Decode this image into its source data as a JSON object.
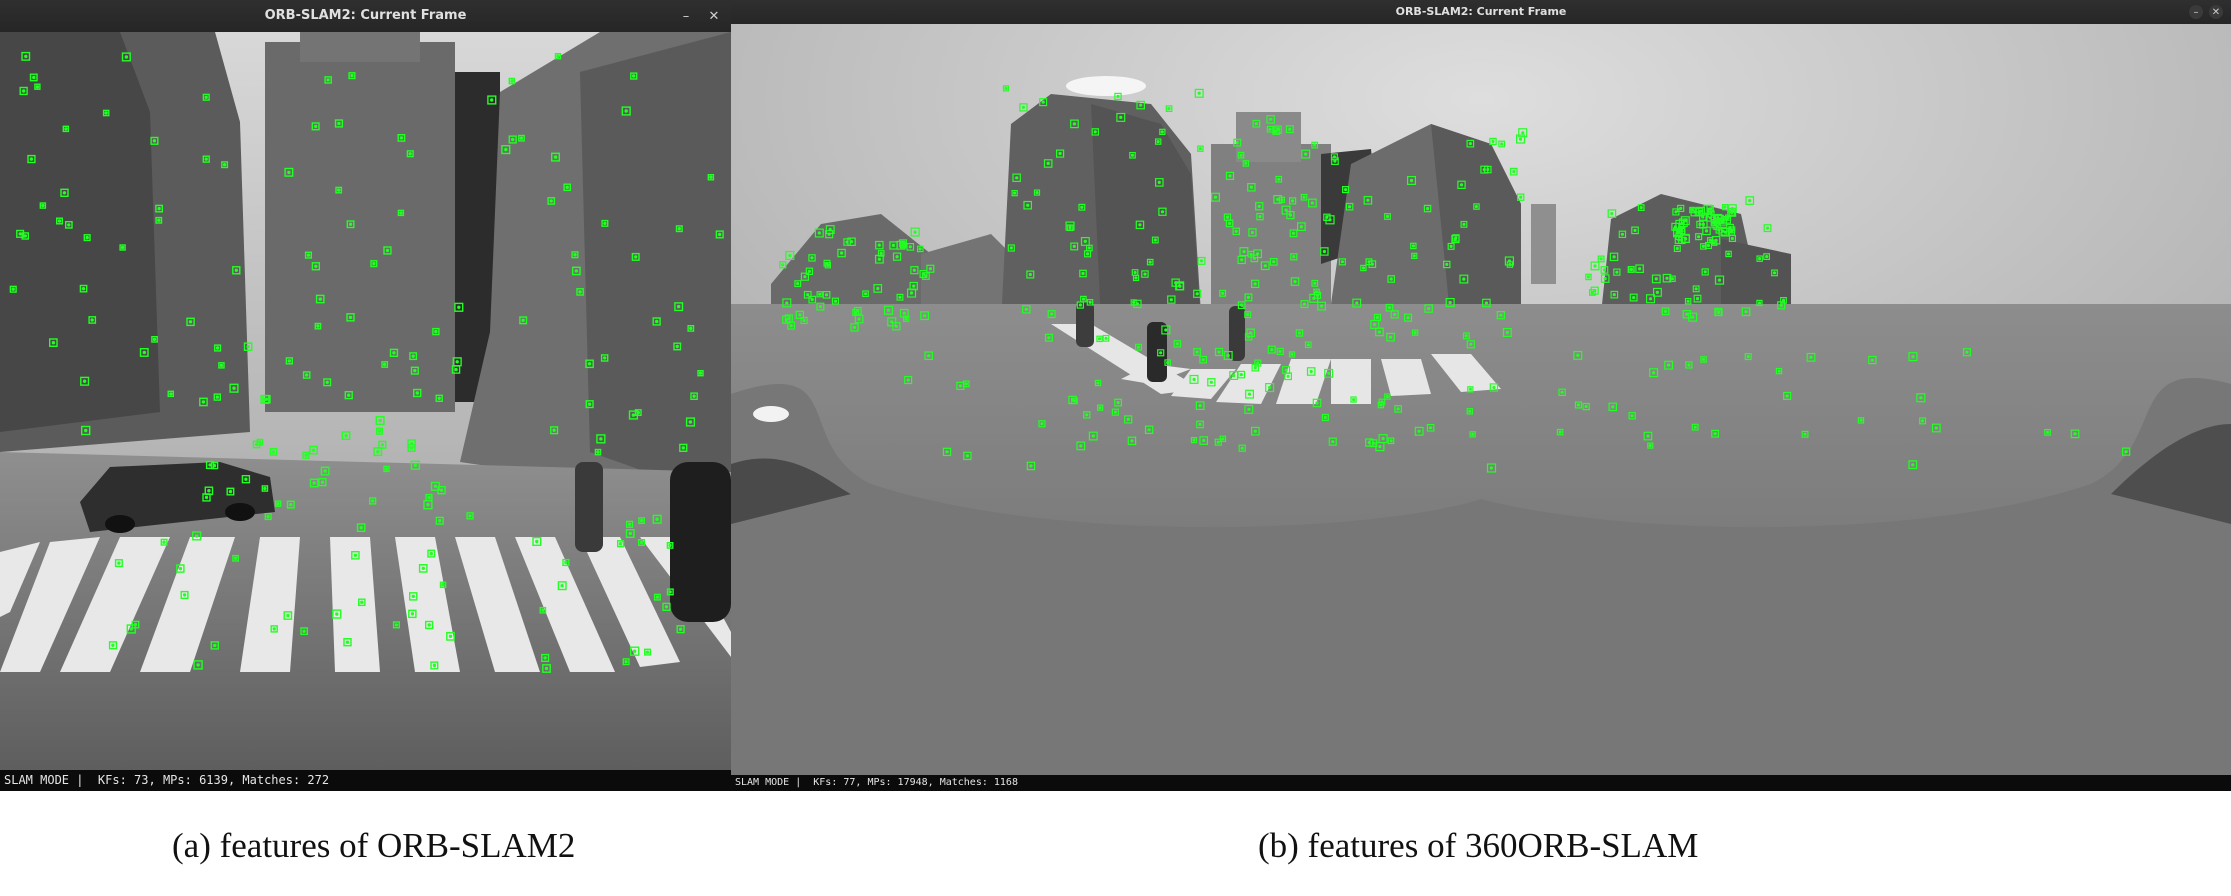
{
  "windows": [
    {
      "title": "ORB-SLAM2: Current Frame",
      "controls": {
        "minimize": "–",
        "close": "✕"
      },
      "status": "SLAM MODE |  KFs: 73, MPs: 6139, Matches: 272"
    },
    {
      "title": "ORB-SLAM2: Current Frame",
      "controls": {
        "minimize": "–",
        "close": "✕"
      },
      "status": "SLAM MODE |  KFs: 77, MPs: 17948, Matches: 1168"
    }
  ],
  "captions": {
    "a": "(a) features of ORB-SLAM2",
    "b": "(b) features of 360ORB-SLAM"
  },
  "colors": {
    "feature": "#22ff22",
    "statusbar": "#0b0b0b",
    "titlebar": "#2b2b2b"
  },
  "icons": [
    "minimize-icon",
    "close-icon"
  ]
}
